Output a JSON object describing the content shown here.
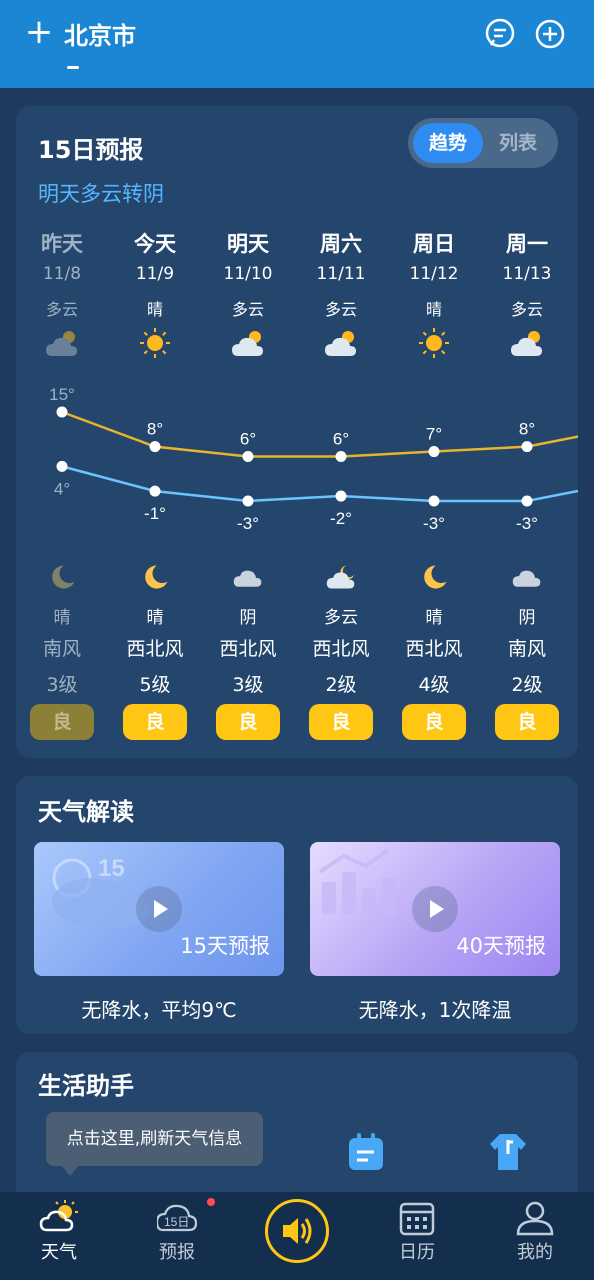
{
  "header": {
    "city": "北京市",
    "add_icon": "plus-icon",
    "message_icon": "message-icon",
    "add_city_icon": "plus-circle-icon",
    "background": "#1b86d4"
  },
  "forecast": {
    "title": "15日预报",
    "subtitle": "明天多云转阴",
    "toggle": {
      "active": "趋势",
      "inactive": "列表"
    },
    "days": [
      {
        "day": "昨天",
        "date": "11/8",
        "cond": "多云",
        "icon": "partly-cloudy-icon",
        "high": "15°",
        "low": "4°",
        "night_cond": "晴",
        "night_icon": "moon-icon",
        "wind": "南风",
        "level": "3级",
        "aqi": "良",
        "past": true
      },
      {
        "day": "今天",
        "date": "11/9",
        "cond": "晴",
        "icon": "sun-icon",
        "high": "8°",
        "low": "-1°",
        "night_cond": "晴",
        "night_icon": "moon-icon",
        "wind": "西北风",
        "level": "5级",
        "aqi": "良",
        "past": false
      },
      {
        "day": "明天",
        "date": "11/10",
        "cond": "多云",
        "icon": "partly-cloudy-icon",
        "high": "6°",
        "low": "-3°",
        "night_cond": "阴",
        "night_icon": "cloud-icon",
        "wind": "西北风",
        "level": "3级",
        "aqi": "良",
        "past": false
      },
      {
        "day": "周六",
        "date": "11/11",
        "cond": "多云",
        "icon": "partly-cloudy-icon",
        "high": "6°",
        "low": "-2°",
        "night_cond": "多云",
        "night_icon": "cloudy-night-icon",
        "wind": "西北风",
        "level": "2级",
        "aqi": "良",
        "past": false
      },
      {
        "day": "周日",
        "date": "11/12",
        "cond": "晴",
        "icon": "sun-icon",
        "high": "7°",
        "low": "-3°",
        "night_cond": "晴",
        "night_icon": "moon-icon",
        "wind": "西北风",
        "level": "4级",
        "aqi": "良",
        "past": false
      },
      {
        "day": "周一",
        "date": "11/13",
        "cond": "多云",
        "icon": "partly-cloudy-icon",
        "high": "8°",
        "low": "-3°",
        "night_cond": "阴",
        "night_icon": "cloud-icon",
        "wind": "南风",
        "level": "2级",
        "aqi": "良",
        "past": false
      }
    ],
    "high_values": [
      15,
      8,
      6,
      6,
      7,
      8
    ],
    "low_values": [
      4,
      -1,
      -3,
      -2,
      -3,
      -3
    ],
    "high_color": "#e8b42a",
    "low_color": "#6cc4ff",
    "aqi_color": "#ffc614"
  },
  "interpretation": {
    "title": "天气解读",
    "videos": [
      {
        "label": "15天预报",
        "caption": "无降水，平均9℃",
        "deco_text": "15"
      },
      {
        "label": "40天预报",
        "caption": "无降水，1次降温"
      }
    ]
  },
  "life": {
    "title": "生活助手",
    "tooltip": "点击这里,刷新天气信息"
  },
  "nav": {
    "items": [
      {
        "label": "天气",
        "icon": "weather-icon"
      },
      {
        "label": "预报",
        "icon": "forecast-icon",
        "icon_text": "15日"
      },
      {
        "label": "日历",
        "icon": "calendar-icon"
      },
      {
        "label": "我的",
        "icon": "profile-icon"
      }
    ],
    "center_icon": "speaker-icon",
    "active": "天气"
  }
}
